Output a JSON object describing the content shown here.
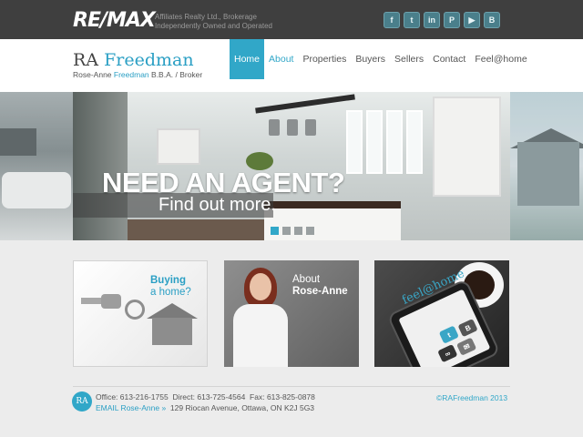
{
  "topbar": {
    "logo": "RE/MAX",
    "brokerage_line1": "Affiliates Realty Ltd., Brokerage",
    "brokerage_line2": "Independently Owned and Operated",
    "social": [
      {
        "name": "facebook-icon",
        "glyph": "f"
      },
      {
        "name": "twitter-icon",
        "glyph": "t"
      },
      {
        "name": "linkedin-icon",
        "glyph": "in"
      },
      {
        "name": "pinterest-icon",
        "glyph": "P"
      },
      {
        "name": "youtube-icon",
        "glyph": "▶"
      },
      {
        "name": "blog-icon",
        "glyph": "B"
      }
    ]
  },
  "header": {
    "name_first": "RA",
    "name_last": "Freedman",
    "sub_first": "Rose-Anne",
    "sub_last": "Freedman",
    "sub_credentials": "B.B.A.  /  Broker"
  },
  "nav": {
    "items": [
      "Home",
      "About",
      "Properties",
      "Buyers",
      "Sellers",
      "Contact",
      "Feel@home"
    ]
  },
  "hero": {
    "title": "NEED AN AGENT?",
    "subtitle": "Find out more."
  },
  "features": {
    "buying_title": "Buying",
    "buying_sub": "a home?",
    "about_title": "About",
    "about_sub": "Rose-Anne",
    "feel_label": "feel@home"
  },
  "footer": {
    "badge": "RA",
    "office": "Office: 613-216-1755",
    "direct": "Direct: 613-725-4564",
    "fax": "Fax: 613-825-0878",
    "email": "EMAIL Rose-Anne »",
    "address": "129 Riocan Avenue, Ottawa, ON K2J 5G3",
    "copyright": "©RAFreedman 2013"
  },
  "colors": {
    "accent": "#31a7c8",
    "topbar": "#3f3f3f"
  }
}
